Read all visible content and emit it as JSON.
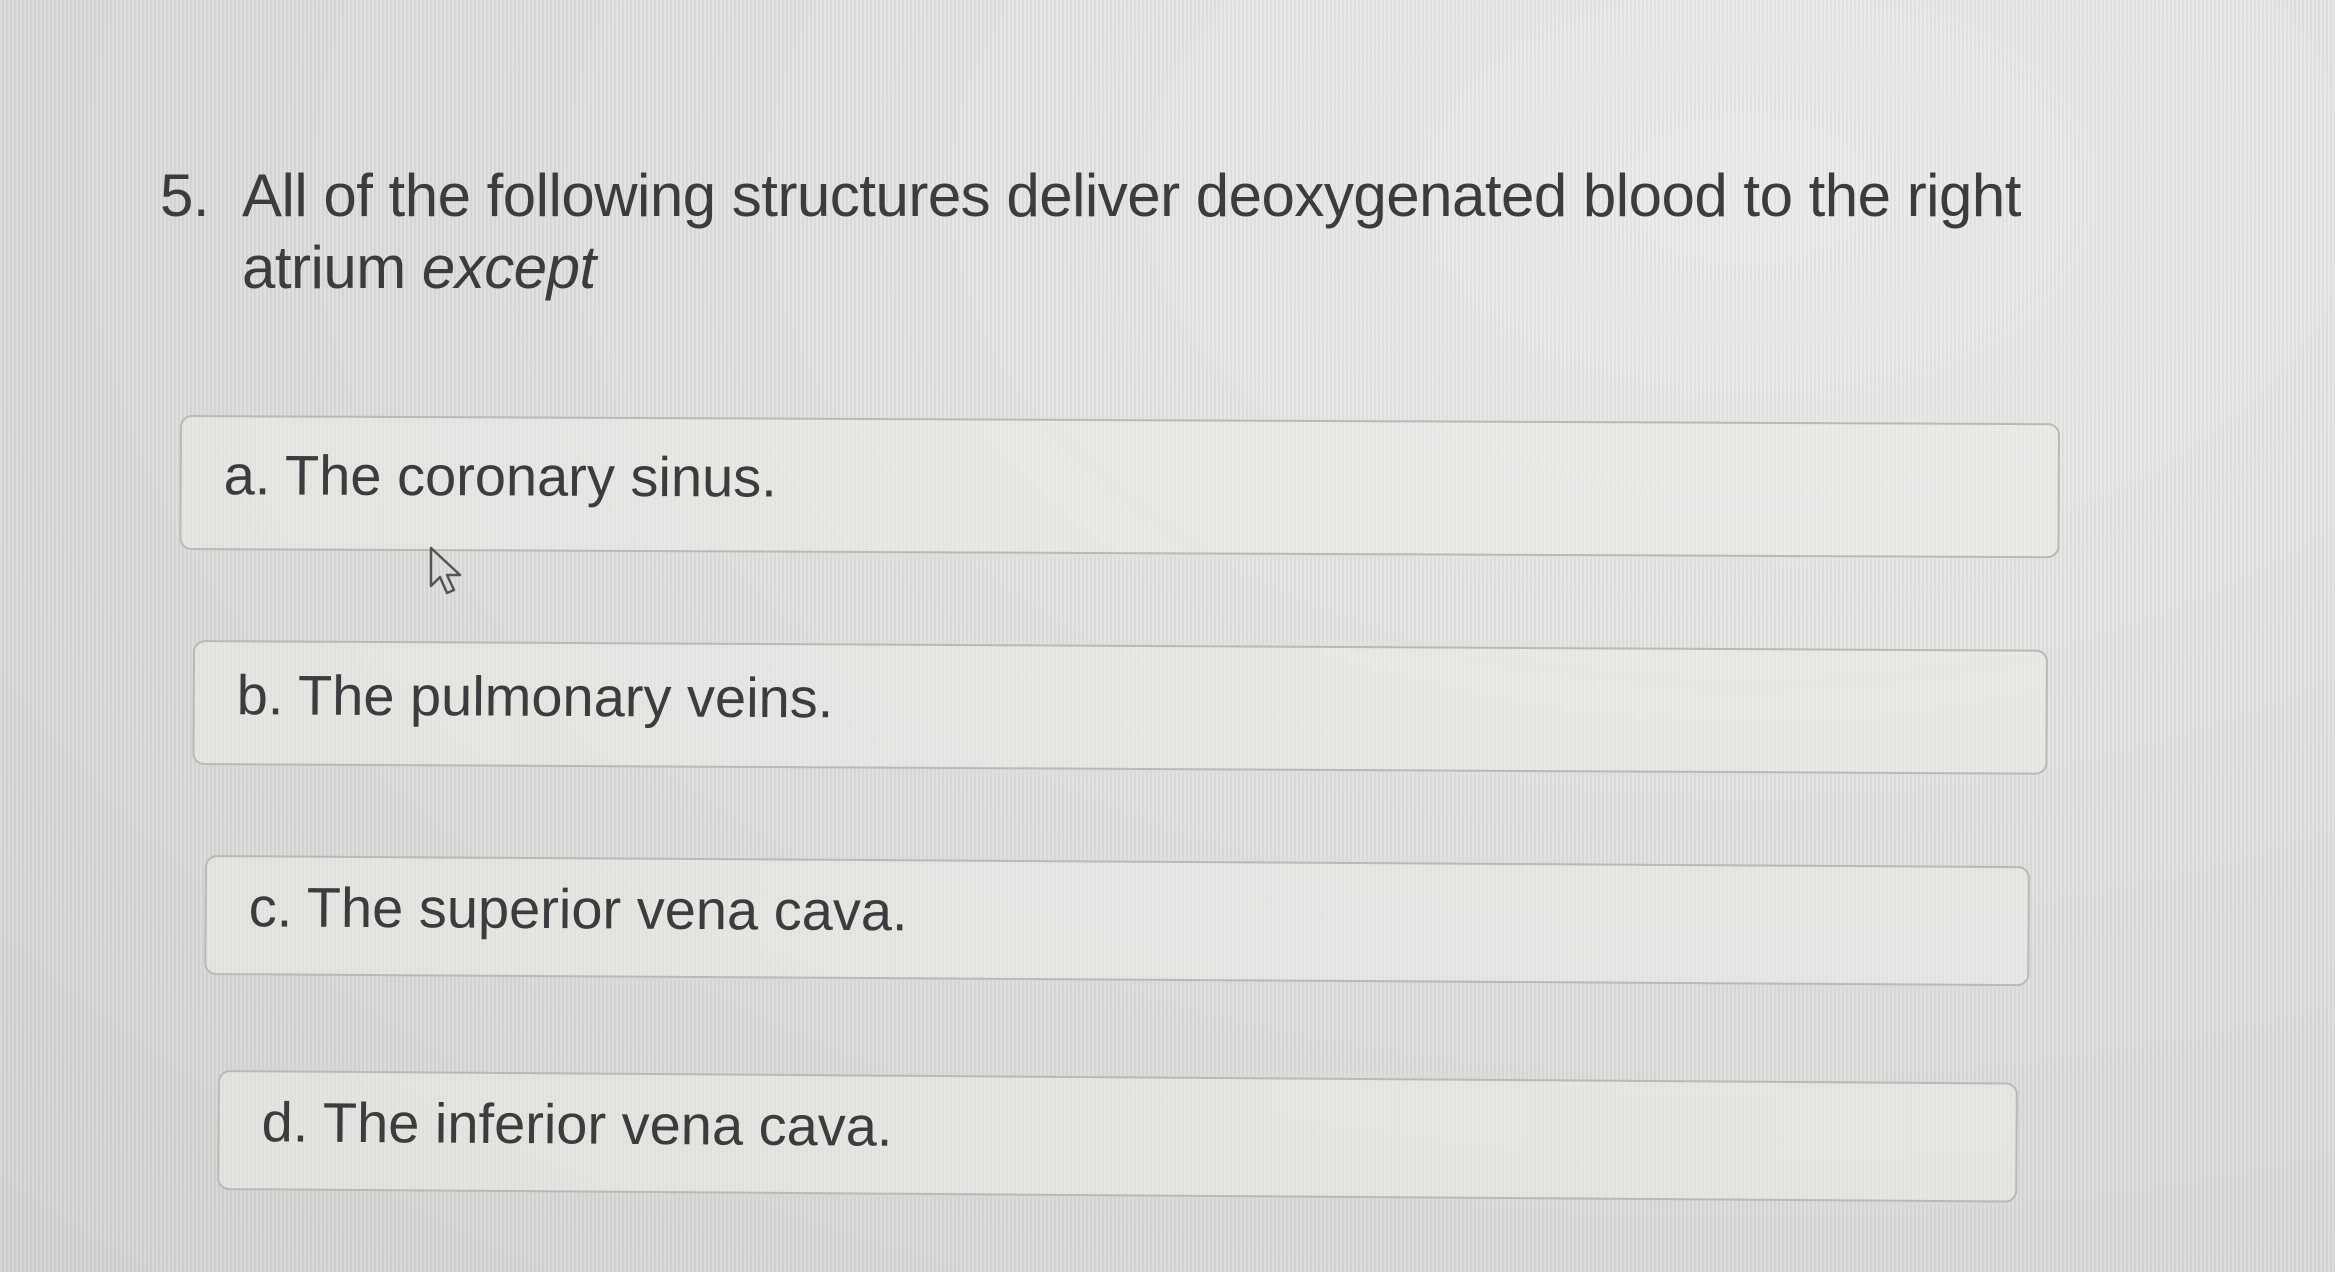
{
  "question": {
    "number": "5.",
    "text_main": "All of the following structures deliver deoxygenated blood to the right atrium",
    "text_emphasis": "except"
  },
  "options": [
    {
      "label": "a. The coronary sinus."
    },
    {
      "label": "b. The pulmonary veins."
    },
    {
      "label": "c. The superior vena cava."
    },
    {
      "label": "d. The inferior vena cava."
    }
  ],
  "cursor": {
    "icon": "mouse-pointer-icon"
  }
}
